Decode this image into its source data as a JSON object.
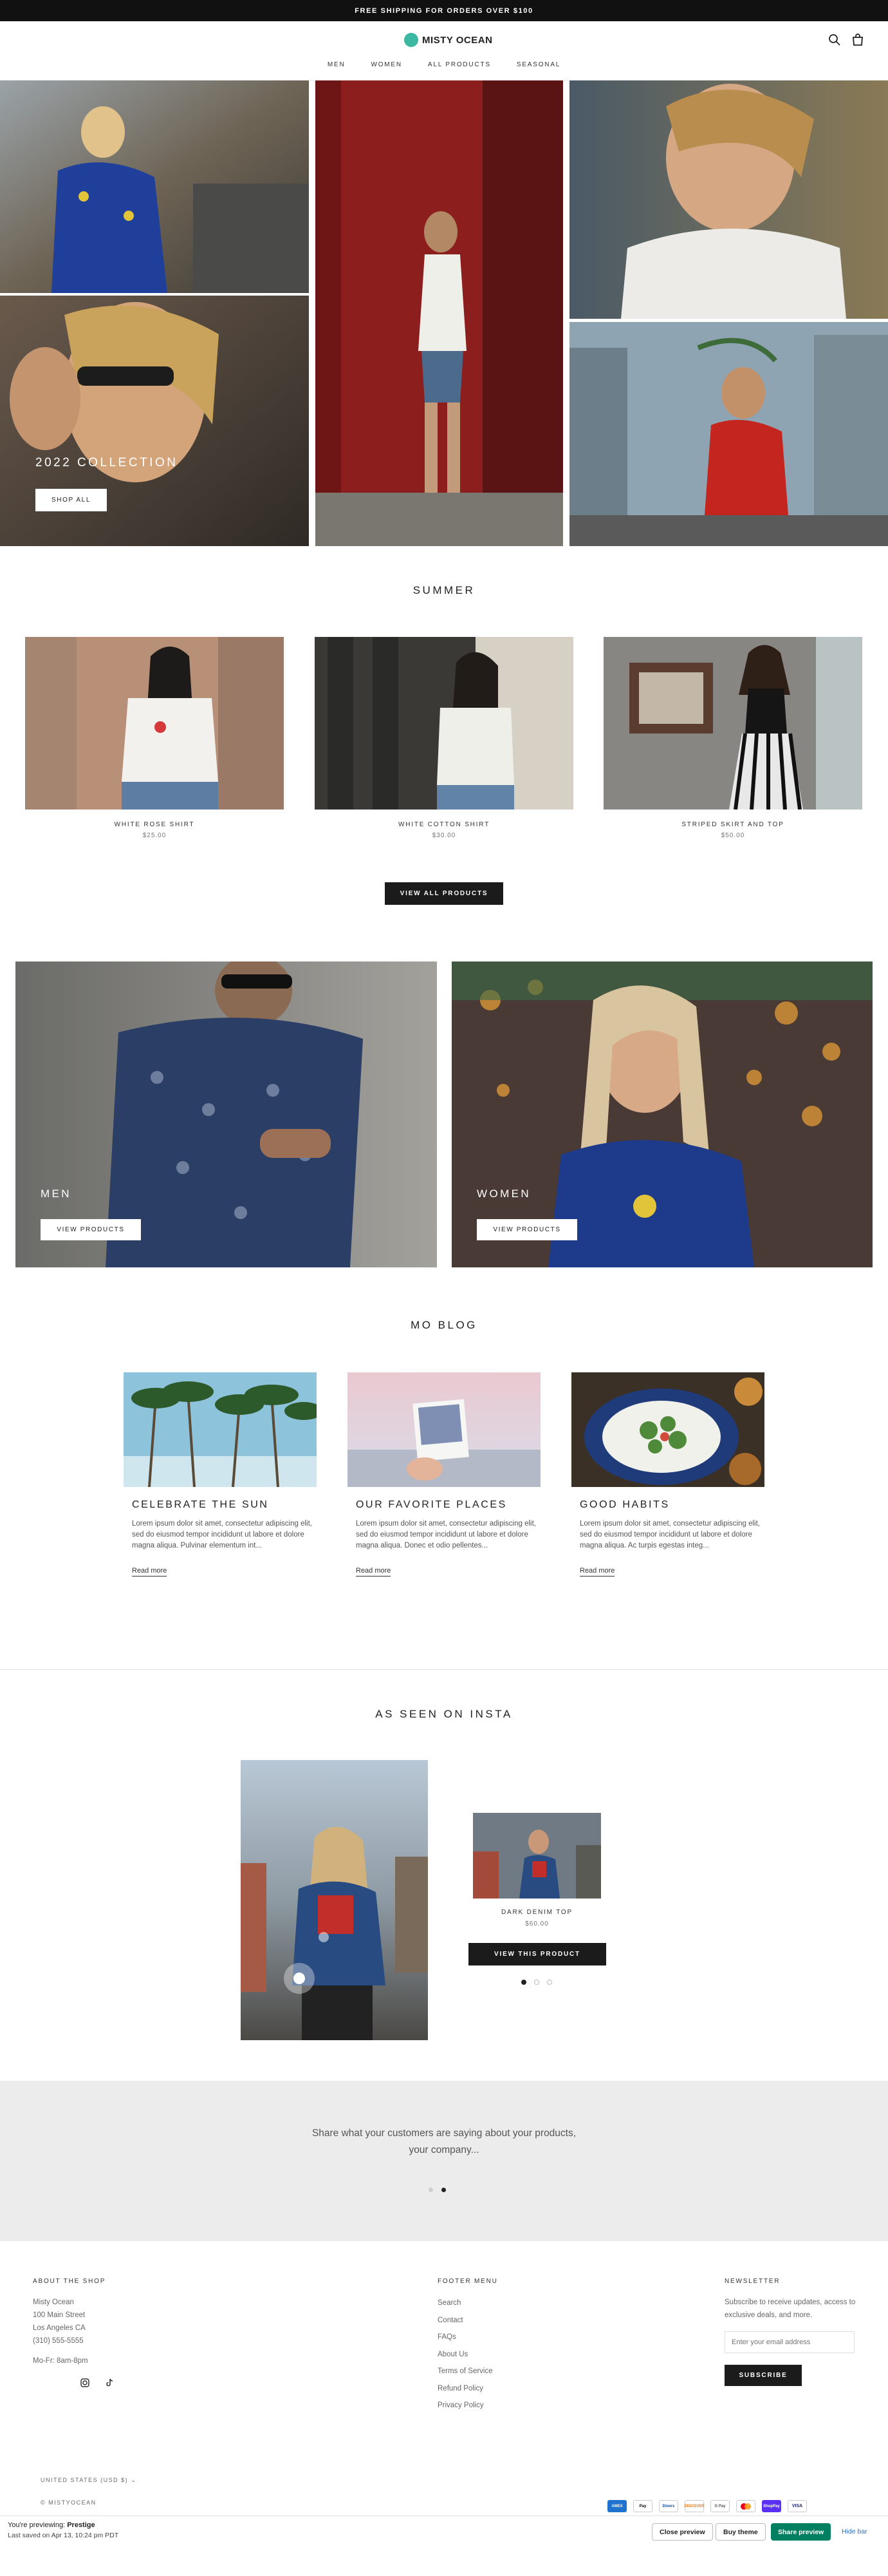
{
  "announcement": "FREE SHIPPING FOR ORDERS OVER $100",
  "brand": {
    "name": "MISTY OCEAN",
    "accent": "#3cb8a2"
  },
  "header_icons": [
    "search-icon",
    "cart-icon"
  ],
  "nav": [
    "MEN",
    "WOMEN",
    "ALL PRODUCTS",
    "SEASONAL"
  ],
  "hero": {
    "title": "2022 COLLECTION",
    "button": "SHOP ALL"
  },
  "summer": {
    "heading": "SUMMER",
    "products": [
      {
        "name": "WHITE ROSE SHIRT",
        "price": "$25.00"
      },
      {
        "name": "WHITE COTTON SHIRT",
        "price": "$30.00"
      },
      {
        "name": "STRIPED SKIRT AND TOP",
        "price": "$50.00"
      }
    ],
    "view_all": "VIEW ALL PRODUCTS"
  },
  "collections": [
    {
      "title": "MEN",
      "button": "VIEW PRODUCTS"
    },
    {
      "title": "WOMEN",
      "button": "VIEW PRODUCTS"
    }
  ],
  "blog": {
    "heading": "MO BLOG",
    "posts": [
      {
        "title": "CELEBRATE THE SUN",
        "excerpt": "Lorem ipsum dolor sit amet, consectetur adipiscing elit, sed do eiusmod tempor incididunt ut labore et dolore magna aliqua. Pulvinar elementum int...",
        "link": "Read more"
      },
      {
        "title": "OUR FAVORITE PLACES",
        "excerpt": "Lorem ipsum dolor sit amet, consectetur adipiscing elit, sed do eiusmod tempor incididunt ut labore et dolore magna aliqua. Donec et odio pellentes...",
        "link": "Read more"
      },
      {
        "title": "GOOD HABITS",
        "excerpt": "Lorem ipsum dolor sit amet, consectetur adipiscing elit, sed do eiusmod tempor incididunt ut labore et dolore magna aliqua. Ac turpis egestas integ...",
        "link": "Read more"
      }
    ]
  },
  "insta": {
    "heading": "AS SEEN ON INSTA",
    "product": {
      "name": "DARK DENIM TOP",
      "price": "$60.00"
    },
    "button": "VIEW THIS PRODUCT",
    "dots": 3,
    "active_dot": 1
  },
  "testimonial": {
    "text_line1": "Share what your customers are saying about your products,",
    "text_line2": "your company...",
    "dots": 2,
    "active_dot": 2
  },
  "footer": {
    "about": {
      "heading": "ABOUT THE SHOP",
      "lines": [
        "Misty Ocean",
        "100 Main Street",
        "Los Angeles CA",
        "(310) 555-5555"
      ],
      "hours": "Mo-Fr: 8am-8pm",
      "social": [
        "instagram-icon",
        "tiktok-icon"
      ]
    },
    "menu": {
      "heading": "FOOTER MENU",
      "links": [
        "Search",
        "Contact",
        "FAQs",
        "About Us",
        "Terms of Service",
        "Refund Policy",
        "Privacy Policy"
      ]
    },
    "newsletter": {
      "heading": "NEWSLETTER",
      "text_line1": "Subscribe to receive updates, access to",
      "text_line2": "exclusive deals, and more.",
      "placeholder": "Enter your email address",
      "button": "SUBSCRIBE"
    },
    "country": "UNITED STATES (USD $)",
    "copyright": "© MISTYOCEAN",
    "payments": [
      "AMEX",
      "Pay",
      "Diners",
      "DISCOVER",
      "G Pay",
      "MC",
      "ShopPay",
      "VISA"
    ]
  },
  "preview_bar": {
    "label": "You're previewing:",
    "theme": "Prestige",
    "saved": "Last saved on Apr 13, 10:24 pm PDT",
    "close": "Close preview",
    "buy": "Buy theme",
    "share": "Share preview",
    "hide": "Hide bar"
  }
}
